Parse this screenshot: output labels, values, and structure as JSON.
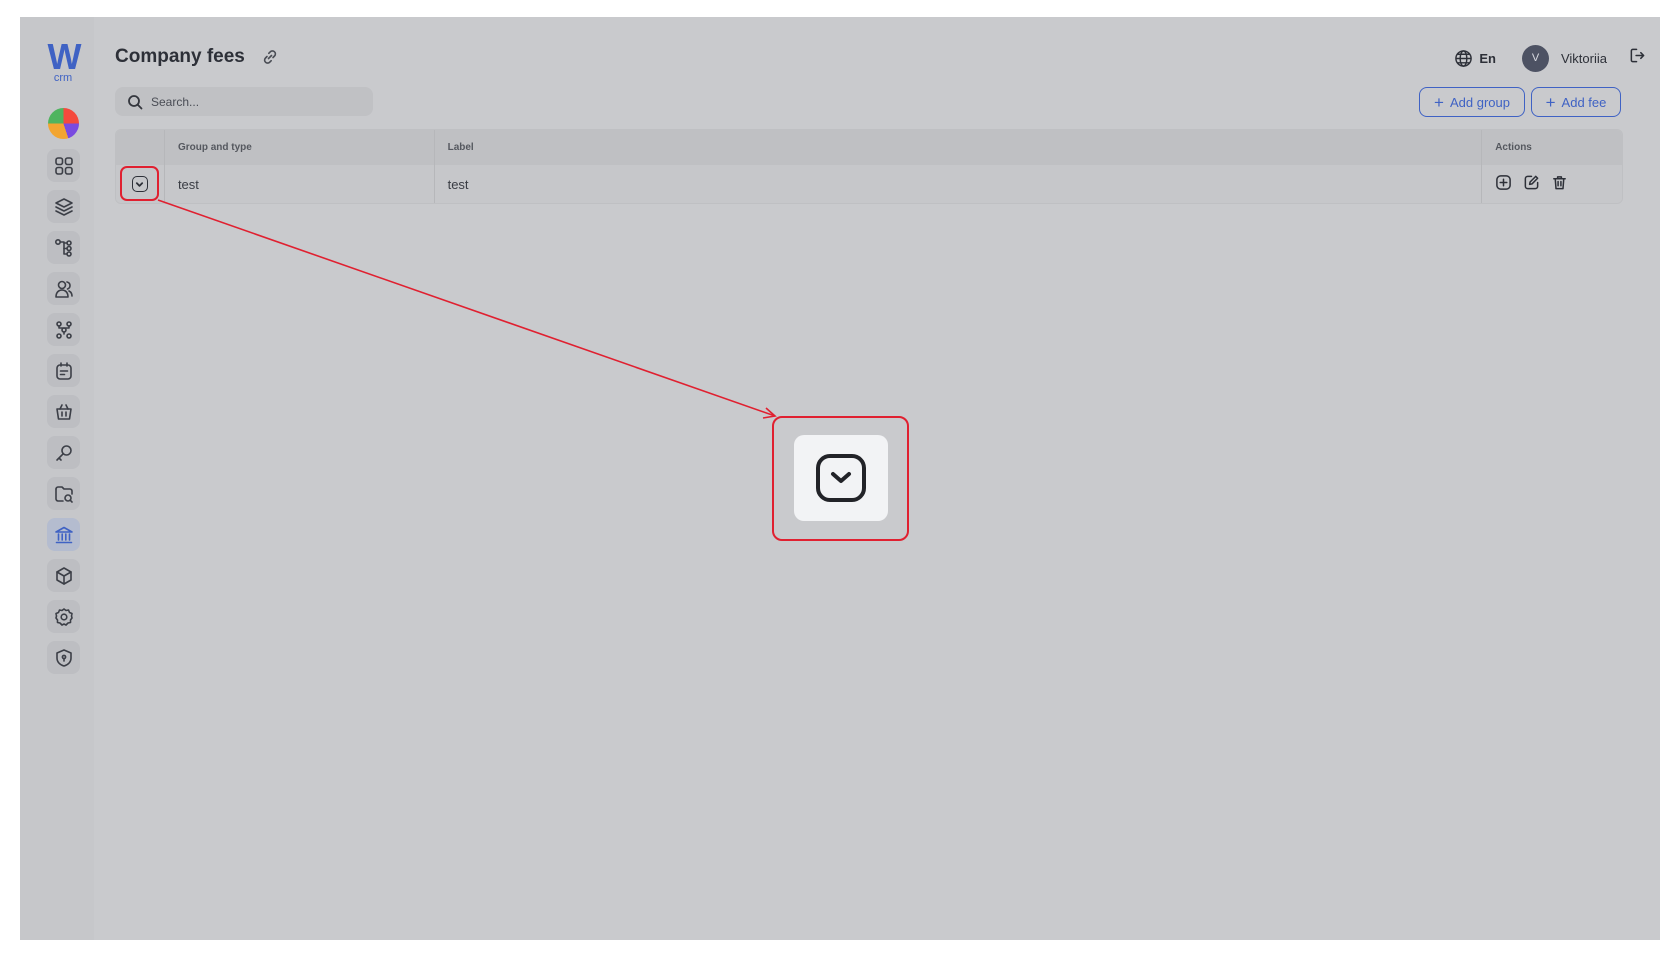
{
  "logo": {
    "mark": "W",
    "sub": "crm"
  },
  "sidebar": {
    "items": [
      {
        "icon": "dashboard-grid-icon"
      },
      {
        "icon": "layers-icon"
      },
      {
        "icon": "hierarchy-icon"
      },
      {
        "icon": "users-icon"
      },
      {
        "icon": "team-structure-icon"
      },
      {
        "icon": "calendar-note-icon"
      },
      {
        "icon": "basket-icon"
      },
      {
        "icon": "key-icon"
      },
      {
        "icon": "folder-search-icon"
      },
      {
        "icon": "bank-icon",
        "active": true
      },
      {
        "icon": "box-icon"
      },
      {
        "icon": "gear-icon"
      },
      {
        "icon": "shield-icon"
      }
    ]
  },
  "header": {
    "title": "Company fees",
    "language": "En",
    "user_initial": "V",
    "user_name": "Viktoriia"
  },
  "search": {
    "placeholder": "Search..."
  },
  "buttons": {
    "add_group": "Add group",
    "add_fee": "Add fee"
  },
  "table": {
    "columns": [
      "",
      "Group and type",
      "Label",
      "Actions"
    ],
    "rows": [
      {
        "group_and_type": "test",
        "label": "test"
      }
    ]
  },
  "colors": {
    "accent": "#3f62c4",
    "annotation": "#e02030",
    "background": "#c9cacd"
  }
}
